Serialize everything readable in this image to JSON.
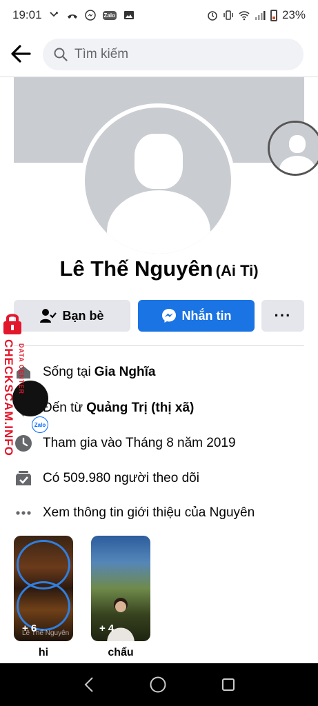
{
  "status_bar": {
    "time": "19:01",
    "battery": "23%",
    "zalo_label": "Zalo"
  },
  "search": {
    "placeholder": "Tìm kiếm"
  },
  "profile": {
    "name": "Lê Thế Nguyên",
    "nickname": "(Ai Ti)"
  },
  "actions": {
    "friends_label": "Bạn bè",
    "message_label": "Nhắn tin",
    "more_label": "···"
  },
  "info": {
    "lives_prefix": "Sống tại",
    "lives_place": "Gia Nghĩa",
    "from_prefix": "Đến từ",
    "from_place": "Quảng Trị (thị xã)",
    "joined": "Tham gia vào Tháng 8 năm 2019",
    "followers": "Có 509.980 người theo dõi",
    "see_about": "Xem thông tin giới thiệu của Nguyên"
  },
  "watermark": {
    "main": "CHECKSCAM.INFO",
    "small": "DATA CENTER",
    "zalo": "Zalo"
  },
  "stories": [
    {
      "label": "hi",
      "count": "+ 6",
      "watermark": "Lê Thế Nguyên"
    },
    {
      "label": "chẩu",
      "count": "+ 4"
    }
  ],
  "colors": {
    "primary": "#1b74e4",
    "secondary_btn": "#e4e6eb",
    "cover": "#c9ccd1",
    "watermark": "#e3172b"
  },
  "icons": {
    "back": "arrow-left-icon",
    "search": "search-icon",
    "friends": "friend-check-icon",
    "messenger": "messenger-icon",
    "home": "home-icon",
    "location": "location-pin-icon",
    "clock": "clock-icon",
    "followers": "followers-icon",
    "more": "more-dots-icon"
  }
}
